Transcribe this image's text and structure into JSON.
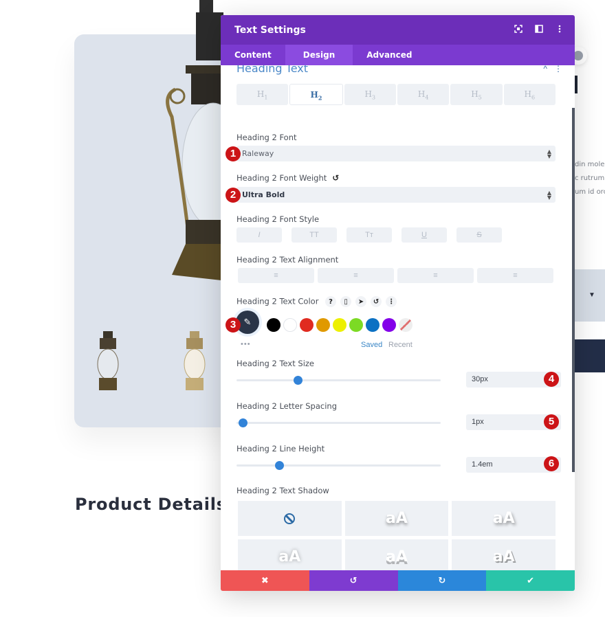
{
  "page": {
    "product_title": "Product Details",
    "right_text_lines": [
      "din mole",
      "c rutrum",
      "um id orc"
    ],
    "right_select_arrow": "▼"
  },
  "modal": {
    "title": "Text Settings",
    "header_icons": [
      "focus-icon",
      "split-view-icon",
      "more-options-icon"
    ],
    "tabs": [
      {
        "label": "Content",
        "active": false
      },
      {
        "label": "Design",
        "active": true
      },
      {
        "label": "Advanced",
        "active": false
      }
    ],
    "section_title": "Heading Text",
    "heading_tabs": [
      {
        "label": "H",
        "sub": "1",
        "active": false
      },
      {
        "label": "H",
        "sub": "2",
        "active": true
      },
      {
        "label": "H",
        "sub": "3",
        "active": false
      },
      {
        "label": "H",
        "sub": "4",
        "active": false
      },
      {
        "label": "H",
        "sub": "5",
        "active": false
      },
      {
        "label": "H",
        "sub": "6",
        "active": false
      }
    ],
    "font": {
      "label": "Heading 2 Font",
      "value": "Raleway",
      "badge": "1"
    },
    "font_weight": {
      "label": "Heading 2 Font Weight",
      "value": "Ultra Bold",
      "badge": "2"
    },
    "font_style": {
      "label": "Heading 2 Font Style",
      "buttons": [
        "I",
        "TT",
        "Tт",
        "U",
        "S"
      ]
    },
    "text_alignment": {
      "label": "Heading 2 Text Alignment",
      "buttons": [
        "≡",
        "≡",
        "≡",
        "≡"
      ]
    },
    "text_color": {
      "label": "Heading 2 Text Color",
      "badge": "3",
      "help_icon": "?",
      "swatches": [
        "#000000",
        "#ffffff",
        "#e02b20",
        "#e09900",
        "#edf000",
        "#7cda24",
        "#0c71c3",
        "#8300e9"
      ],
      "more": "•••",
      "saved_label": "Saved",
      "recent_label": "Recent"
    },
    "text_size": {
      "label": "Heading 2 Text Size",
      "value": "30px",
      "badge": "4",
      "slider_fraction": 0.3
    },
    "letter_spacing": {
      "label": "Heading 2 Letter Spacing",
      "value": "1px",
      "badge": "5",
      "slider_fraction": 0.03
    },
    "line_height": {
      "label": "Heading 2 Line Height",
      "value": "1.4em",
      "badge": "6",
      "slider_fraction": 0.21
    },
    "text_shadow": {
      "label": "Heading 2 Text Shadow",
      "preview_text": "aA"
    },
    "footer": {
      "cancel_color": "#ef5555",
      "undo_color": "#7e3bd0",
      "redo_color": "#2b87da",
      "save_color": "#29c4a9"
    }
  }
}
